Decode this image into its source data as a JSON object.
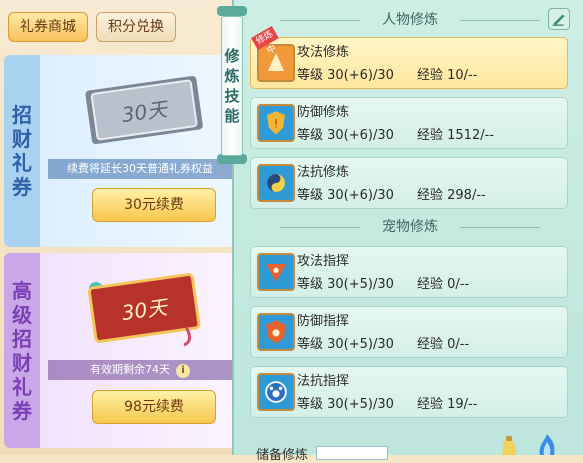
{
  "tabs": {
    "shop": "礼券商城",
    "exchange": "积分兑换"
  },
  "cards": [
    {
      "title_chars": [
        "招",
        "财",
        "礼",
        "券"
      ],
      "ticket_text": "30天",
      "note": "续费将延长30天普通礼券权益",
      "button": "30元续费"
    },
    {
      "title_chars": [
        "高",
        "级",
        "招",
        "财",
        "礼",
        "券"
      ],
      "ticket_text": "30天",
      "note": "有效期剩余74天",
      "button": "98元续费"
    }
  ],
  "scroll_title": [
    "修",
    "炼",
    "技",
    "能"
  ],
  "sections": {
    "character": {
      "title": "人物修炼",
      "rows": [
        {
          "name": "攻法修炼",
          "level": "等级 30(+6)/30",
          "exp": "经验 10/--",
          "badge": "修炼中",
          "selected": true,
          "icon": "attack-magic-icon"
        },
        {
          "name": "防御修炼",
          "level": "等级 30(+6)/30",
          "exp": "经验 1512/--",
          "badge": "",
          "selected": false,
          "icon": "defense-icon"
        },
        {
          "name": "法抗修炼",
          "level": "等级 30(+6)/30",
          "exp": "经验 298/--",
          "badge": "",
          "selected": false,
          "icon": "magic-resist-icon"
        }
      ]
    },
    "pet": {
      "title": "宠物修炼",
      "rows": [
        {
          "name": "攻法指挥",
          "level": "等级 30(+5)/30",
          "exp": "经验 0/--",
          "icon": "pet-attack-icon"
        },
        {
          "name": "防御指挥",
          "level": "等级 30(+5)/30",
          "exp": "经验 0/--",
          "icon": "pet-defense-icon"
        },
        {
          "name": "法抗指挥",
          "level": "等级 30(+5)/30",
          "exp": "经验 19/--",
          "icon": "pet-resist-icon"
        }
      ]
    }
  },
  "bottom": {
    "label": "储备修炼"
  },
  "colors": {
    "accent": "#f4c25a",
    "panel": "#cdeee4",
    "badge": "#e8454a"
  }
}
